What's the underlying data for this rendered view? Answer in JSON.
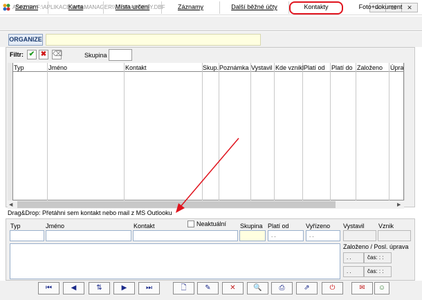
{
  "window": {
    "title": "ADRESY F:\\APLIKACE.WIN\\MANAGER\\VZOR\\ADRESY.DBF",
    "minimize_label": "–",
    "maximize_label": "□",
    "close_label": "✕"
  },
  "tabs": [
    {
      "label": "Seznam"
    },
    {
      "label": "Karta"
    },
    {
      "label": "Místa určení"
    },
    {
      "label": "Záznamy"
    },
    {
      "label": "Další běžné účty"
    },
    {
      "label": "Kontakty",
      "active": true
    },
    {
      "label": "Foto+dokument"
    }
  ],
  "org": {
    "label": "ORGANIZE",
    "value": ""
  },
  "filter": {
    "label": "Filtr:",
    "apply_icon": "check-icon",
    "clear_icon": "x-icon",
    "eraser_icon": "eraser-icon",
    "skupina_label": "Skupina",
    "skupina_value": ""
  },
  "grid": {
    "columns": [
      "Typ",
      "Jméno",
      "Kontakt",
      "Skup.",
      "Poznámka",
      "Vystavil",
      "Kde vznikl",
      "Platí od",
      "Platí do",
      "Založeno",
      "Úprava"
    ],
    "rows": []
  },
  "drag_hint": "Drag&Drop: Přetáhni sem kontakt nebo mail z MS Outlooku",
  "detail": {
    "typ_label": "Typ",
    "jmeno_label": "Jméno",
    "kontakt_label": "Kontakt",
    "neaktualni_label": "Neaktuální",
    "skupina_label": "Skupina",
    "plati_od_label": "Platí od",
    "vyrizeno_label": "Vyřízeno",
    "vystavil_label": "Vystavil",
    "vznik_label": "Vznik",
    "plati_od_value": ". .",
    "vyrizeno_value": ". .",
    "zalozeno_label": "Založeno / Posl. úprava",
    "zal_date1": ". .",
    "zal_time1": "čas: : :",
    "zal_date2": ". .",
    "zal_time2": "čas: : :"
  },
  "toolbar": {
    "buttons": [
      "first-icon",
      "prev-icon",
      "sort-icon",
      "next-icon",
      "last-icon",
      "new-icon",
      "edit-icon",
      "delete-icon",
      "find-icon",
      "print-icon",
      "export-icon",
      "power-icon",
      "mail-icon",
      "person-icon"
    ]
  },
  "colors": {
    "accent_red": "#e0141e",
    "field_yellow": "#ffffe0",
    "annotation_arrow": "#e0141e"
  }
}
